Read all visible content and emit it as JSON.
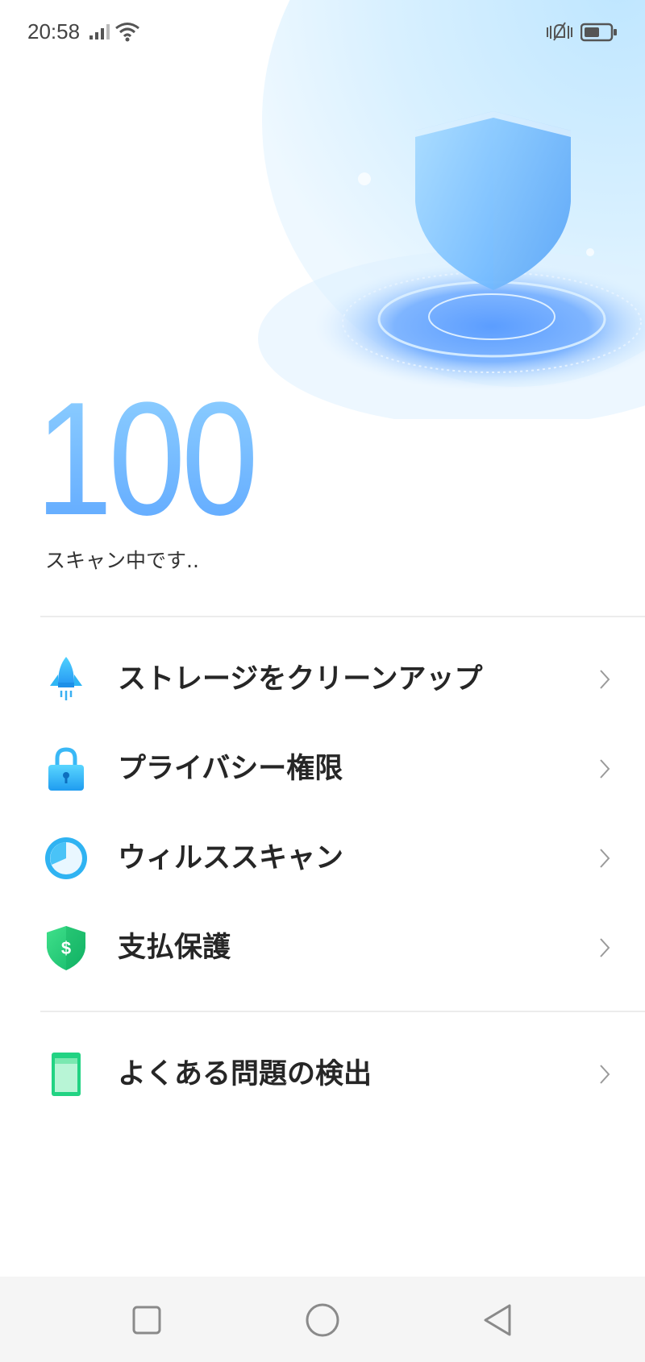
{
  "status_bar": {
    "time": "20:58",
    "icons": [
      "signal-icon",
      "wifi-icon",
      "vibrate-icon",
      "battery-icon"
    ]
  },
  "hero": {
    "score": "100",
    "status_text": "スキャン中です..",
    "icon": "shield-icon"
  },
  "menu": {
    "items": [
      {
        "label": "ストレージをクリーンアップ",
        "icon": "rocket-icon"
      },
      {
        "label": "プライバシー権限",
        "icon": "lock-icon"
      },
      {
        "label": "ウィルススキャン",
        "icon": "scan-dial-icon"
      },
      {
        "label": "支払保護",
        "icon": "payment-shield-icon"
      }
    ],
    "secondary": [
      {
        "label": "よくある問題の検出",
        "icon": "phone-check-icon"
      }
    ]
  },
  "nav_bar": {
    "buttons": [
      "recents-button",
      "home-button",
      "back-button"
    ]
  },
  "colors": {
    "accent_blue": "#5fa8ff",
    "light_blue": "#8fd0ff",
    "green": "#1dc97a",
    "nav_bg": "#f5f5f5"
  }
}
